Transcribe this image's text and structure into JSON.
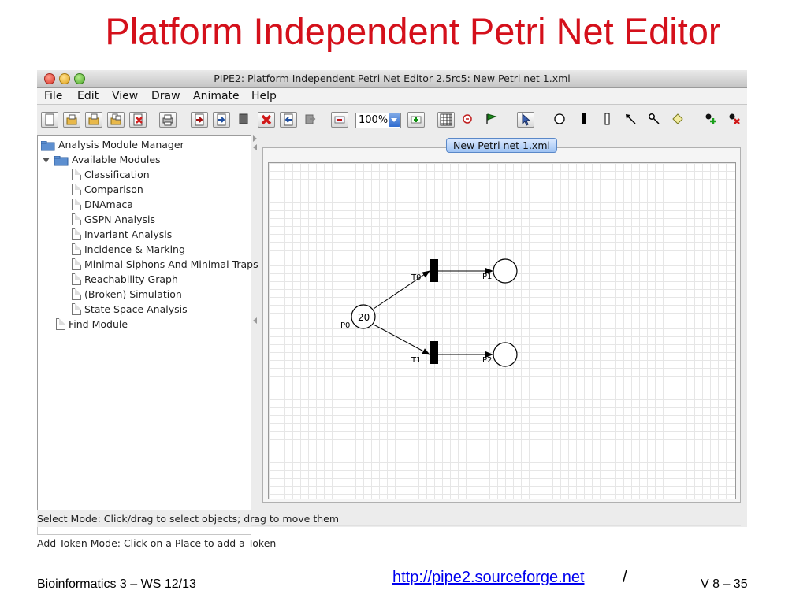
{
  "slide": {
    "title": "Platform Independent Petri Net Editor",
    "footer_left": "Bioinformatics 3 – WS 12/13",
    "footer_link": "http://pipe2.sourceforge.net",
    "footer_slash": "/",
    "footer_right": "V 8 –  35"
  },
  "window": {
    "title": "PIPE2: Platform Independent Petri Net Editor 2.5rc5: New Petri net 1.xml"
  },
  "menu": [
    "File",
    "Edit",
    "View",
    "Draw",
    "Animate",
    "Help"
  ],
  "toolbar": {
    "zoom_value": "100%",
    "icons": [
      "new-file-icon",
      "open-folder-icon",
      "save-icon",
      "save-as-icon",
      "close-file-icon",
      "print-icon",
      "export-icon",
      "export-2-icon",
      "import-icon",
      "delete-icon",
      "undo-icon",
      "redo-icon",
      "zoom-out-icon",
      "zoom-in-icon",
      "grid-icon",
      "animate-stop-icon",
      "flag-icon",
      "select-pointer-icon",
      "place-icon",
      "timed-transition-icon",
      "immediate-transition-icon",
      "arc-icon",
      "inhibitor-arc-icon",
      "annotation-icon",
      "add-token-icon",
      "delete-token-icon"
    ]
  },
  "module_tree": {
    "root": "Analysis Module Manager",
    "folder": "Available Modules",
    "modules": [
      "Classification",
      "Comparison",
      "DNAmaca",
      "GSPN Analysis",
      "Invariant Analysis",
      "Incidence & Marking",
      "Minimal Siphons And Minimal Traps",
      "Reachability Graph",
      "(Broken) Simulation",
      "State Space Analysis"
    ],
    "find": "Find Module"
  },
  "tab": {
    "label": "New Petri net 1.xml"
  },
  "petri_net": {
    "place_p0_label": "P0",
    "place_p0_tokens": "20",
    "place_p1_label": "P1",
    "place_p2_label": "P2",
    "transition_t0_label": "T0",
    "transition_t1_label": "T1"
  },
  "status": {
    "select_mode": "Select Mode: Click/drag to select objects; drag to move them",
    "token_mode": "Add Token Mode: Click on a Place to add a Token"
  }
}
